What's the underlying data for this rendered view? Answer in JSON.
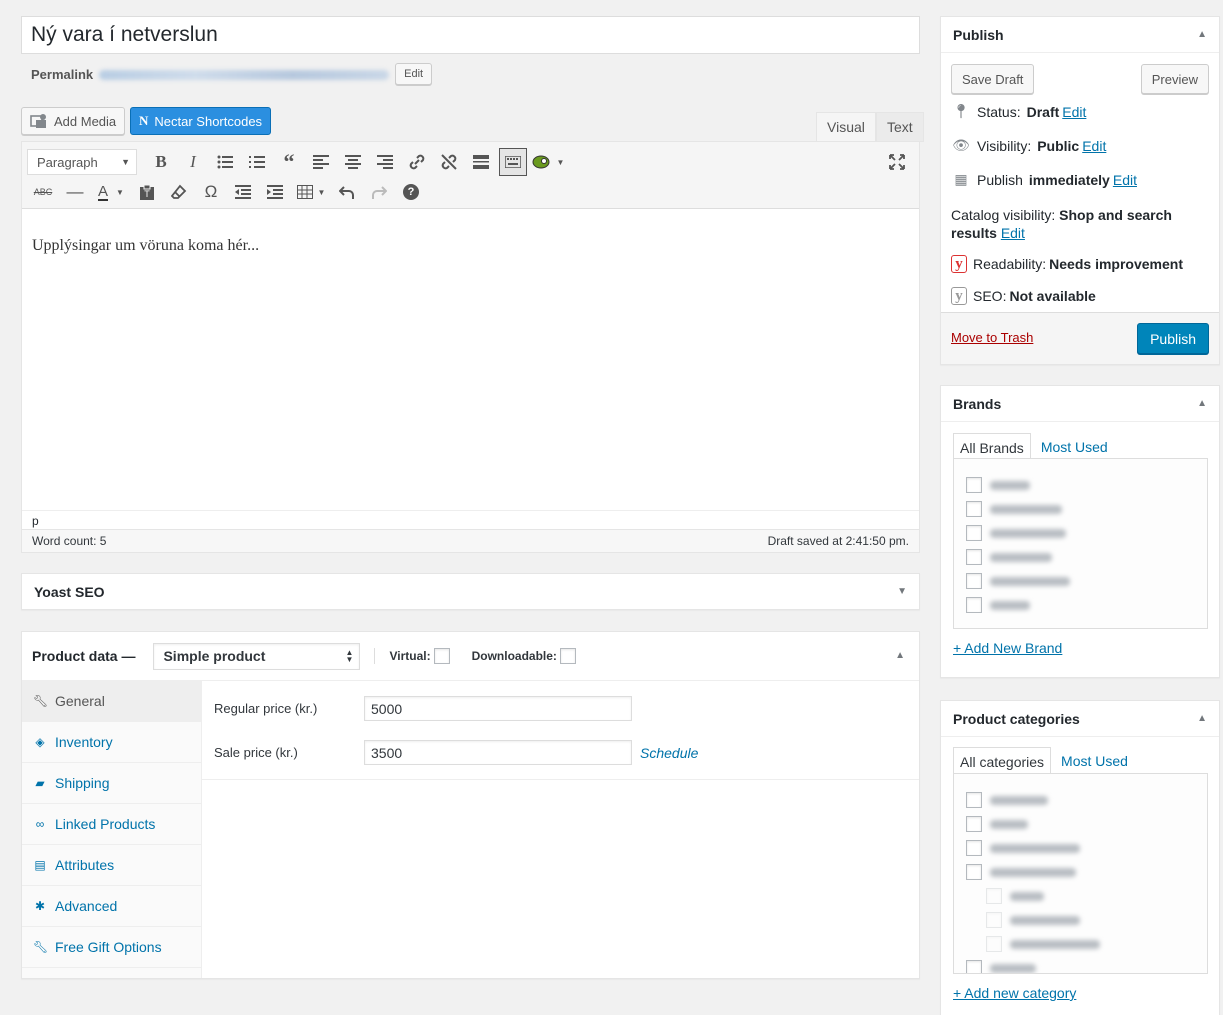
{
  "post": {
    "title": "Ný vara í netverslun",
    "permalink_label": "Permalink",
    "permalink_edit": "Edit"
  },
  "media": {
    "add_media": "Add Media",
    "nectar": "Nectar Shortcodes"
  },
  "editor": {
    "tab_visual": "Visual",
    "tab_text": "Text",
    "format": "Paragraph",
    "content": "Upplýsingar um vöruna koma hér...",
    "path": "p",
    "word_count": "Word count: 5",
    "draft_saved": "Draft saved at 2:41:50 pm."
  },
  "yoast": {
    "title": "Yoast SEO"
  },
  "product_data": {
    "title": "Product data —",
    "type": "Simple product",
    "virtual": "Virtual:",
    "downloadable": "Downloadable:",
    "tabs": [
      {
        "label": "General",
        "icon": "wrench-icon"
      },
      {
        "label": "Inventory",
        "icon": "tag-icon"
      },
      {
        "label": "Shipping",
        "icon": "truck-icon"
      },
      {
        "label": "Linked Products",
        "icon": "link-icon"
      },
      {
        "label": "Attributes",
        "icon": "list-icon"
      },
      {
        "label": "Advanced",
        "icon": "gear-icon"
      },
      {
        "label": "Free Gift Options",
        "icon": "wrench-icon"
      }
    ],
    "regular_price_label": "Regular price (kr.)",
    "regular_price": "5000",
    "sale_price_label": "Sale price (kr.)",
    "sale_price": "3500",
    "schedule": "Schedule"
  },
  "publish": {
    "title": "Publish",
    "save_draft": "Save Draft",
    "preview": "Preview",
    "status_label": "Status:",
    "status_value": "Draft",
    "visibility_label": "Visibility:",
    "visibility_value": "Public",
    "publish_label": "Publish",
    "publish_value": "immediately",
    "catalog_label": "Catalog visibility:",
    "catalog_value_1": "Shop and search",
    "catalog_value_2": "results",
    "readability_label": "Readability:",
    "readability_value": "Needs improvement",
    "seo_label": "SEO:",
    "seo_value": "Not available",
    "edit": "Edit",
    "trash": "Move to Trash",
    "publish_button": "Publish"
  },
  "brands": {
    "title": "Brands",
    "tab_all": "All Brands",
    "tab_most_used": "Most Used",
    "add_new": "+ Add New Brand"
  },
  "categories": {
    "title": "Product categories",
    "tab_all": "All categories",
    "tab_most_used": "Most Used",
    "add_new": "+ Add new category"
  },
  "colors": {
    "link": "#0073aa",
    "publish_button": "#0085ba",
    "nectar_button": "#2b8fe0",
    "trash": "#aa0000",
    "yoast_red": "#dc3232"
  }
}
